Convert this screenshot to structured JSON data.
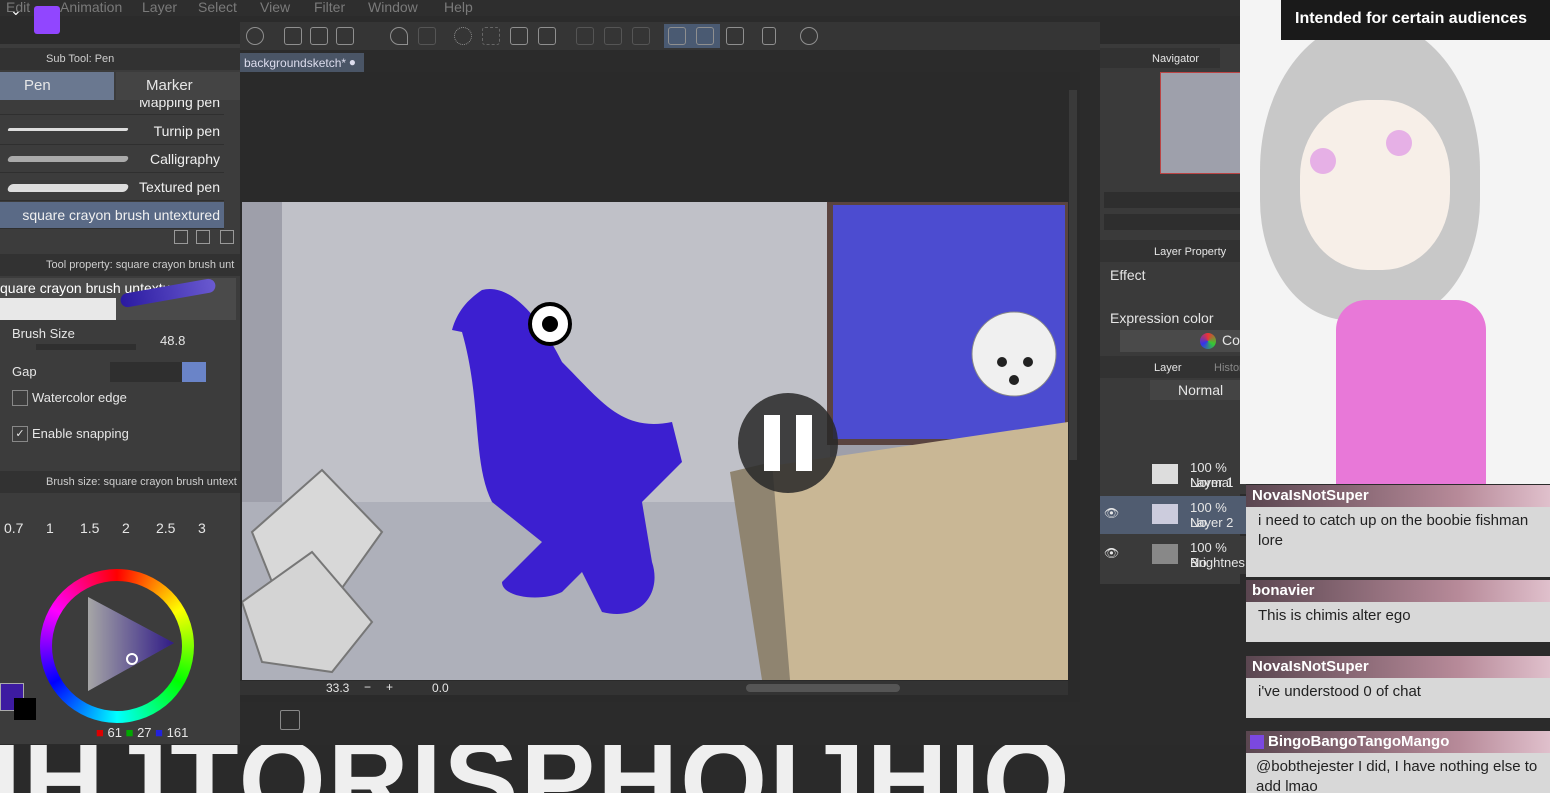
{
  "menu": [
    "Edit",
    "Animation",
    "Layer",
    "Select",
    "View",
    "Filter",
    "Window",
    "Help"
  ],
  "sub_tool_title": "Sub Tool: Pen",
  "tabs": [
    "Pen",
    "Marker"
  ],
  "brushes": [
    "Mapping pen",
    "Turnip pen",
    "Calligraphy",
    "Textured pen",
    "square crayon brush untextured"
  ],
  "tool_property_title": "Tool property: square crayon brush unt",
  "tool_preview_name": "quare crayon brush untextured",
  "brush_size_label": "Brush Size",
  "brush_size_value": "48.8",
  "gap_label": "Gap",
  "watercolor_label": "Watercolor edge",
  "snapping_label": "Enable snapping",
  "brush_size_panel_title": "Brush size: square crayon brush untext",
  "size_presets": [
    "0.7",
    "1",
    "1.5",
    "2",
    "2.5",
    "3"
  ],
  "rgb": [
    "61",
    "27",
    "161"
  ],
  "doc_tab": "backgroundsketch*",
  "zoom_value": "33.3",
  "rotation_value": "0.0",
  "navigator_title": "Navigator",
  "layer_property_title": "Layer Property",
  "effect_label": "Effect",
  "expression_label": "Expression color",
  "color_button": "Color",
  "layer_title": "Layer",
  "history_tab": "History",
  "blend_mode": "Normal",
  "layers": [
    {
      "pct": "100 % Normal",
      "name": "Layer 1"
    },
    {
      "pct": "100 % No",
      "name": "Layer 2"
    },
    {
      "pct": "100 % No",
      "name": "Brightnes"
    }
  ],
  "audience_notice": "Intended for certain audiences",
  "chat": [
    {
      "user": "NovaIsNotSuper",
      "message": "i need to catch up on the boobie fishman lore"
    },
    {
      "user": "bonavier",
      "message": "This is chimis alter ego"
    },
    {
      "user": "NovaIsNotSuper",
      "message": "i've understood 0 of chat"
    },
    {
      "user": "BingoBangoTangoMango",
      "message": "@bobthejester I did, I have nothing else to add lmao"
    }
  ],
  "overlay_text": "IHJTORISPHOIJHIO",
  "colors": {
    "accent": "#3d1ba1",
    "window_blue": "#4c4cd0",
    "fish": "#3c1fd0"
  }
}
